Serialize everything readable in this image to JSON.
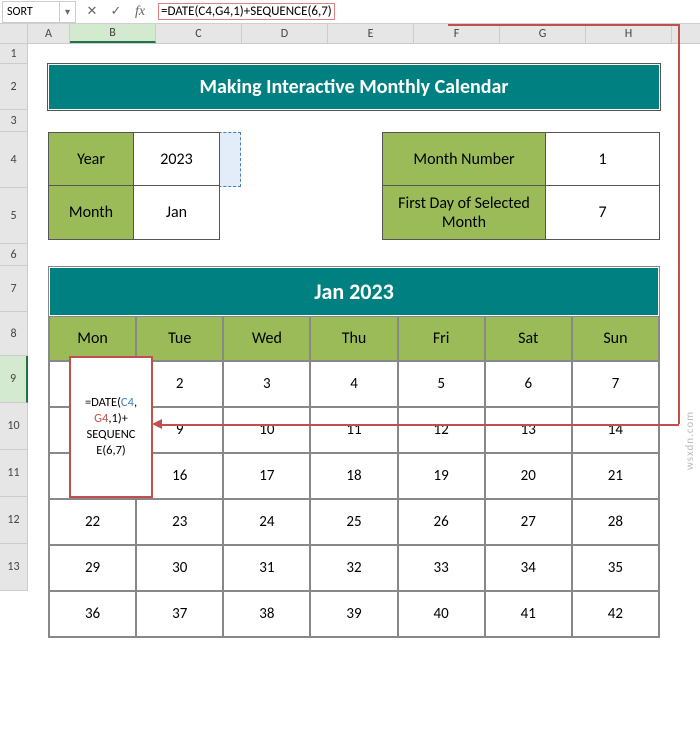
{
  "name_box": "SORT",
  "formula": "=DATE(C4,G4,1)+SEQUENCE(6,7)",
  "columns": [
    "A",
    "B",
    "C",
    "D",
    "E",
    "F",
    "G",
    "H"
  ],
  "rows": [
    "1",
    "2",
    "3",
    "4",
    "5",
    "6",
    "7",
    "8",
    "9",
    "10",
    "11",
    "12",
    "13"
  ],
  "title": "Making Interactive Monthly Calendar",
  "info": {
    "year_label": "Year",
    "year_value": "2023",
    "month_label": "Month",
    "month_value": "Jan",
    "month_num_label": "Month Number",
    "month_num_value": "1",
    "first_day_label": "First Day of Selected Month",
    "first_day_value": "7"
  },
  "calendar": {
    "title": "Jan 2023",
    "days": [
      "Mon",
      "Tue",
      "Wed",
      "Thu",
      "Fri",
      "Sat",
      "Sun"
    ],
    "grid": [
      [
        "",
        "2",
        "3",
        "4",
        "5",
        "6",
        "7"
      ],
      [
        "",
        "9",
        "10",
        "11",
        "12",
        "13",
        "14"
      ],
      [
        "",
        "16",
        "17",
        "18",
        "19",
        "20",
        "21"
      ],
      [
        "22",
        "23",
        "24",
        "25",
        "26",
        "27",
        "28"
      ],
      [
        "29",
        "30",
        "31",
        "32",
        "33",
        "34",
        "35"
      ],
      [
        "36",
        "37",
        "38",
        "39",
        "40",
        "41",
        "42"
      ]
    ]
  },
  "formula_cell": {
    "p1": "=DATE(",
    "c4": "C4",
    "comma": ",",
    "g4": "G4",
    "p2": ",1)+",
    "p3": "SEQUENC",
    "p4": "E(6,7)"
  },
  "watermark": "wsxdn.com"
}
